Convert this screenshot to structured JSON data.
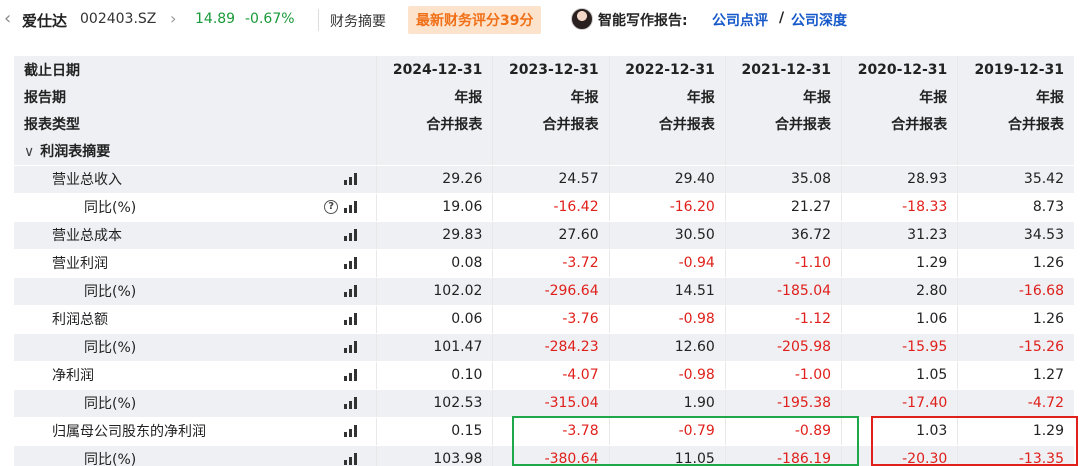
{
  "header": {
    "back_icon": "chevron-left-icon",
    "stock_name": "爱仕达",
    "stock_code": "002403.SZ",
    "chevron": "chevron-right-icon",
    "price": "14.89",
    "change": "-0.67%",
    "financial_summary": "财务摘要",
    "rating_badge": "最新财务评分39分",
    "ai_label": "智能写作报告:",
    "ai_link_1": "公司点评",
    "ai_slash": "/",
    "ai_link_2": "公司深度",
    "up_color": "#1a9a3a",
    "link_color": "#1558c9",
    "badge_color": "#f07018"
  },
  "table": {
    "header_rows": [
      {
        "label": "截止日期",
        "values": [
          "2024-12-31",
          "2023-12-31",
          "2022-12-31",
          "2021-12-31",
          "2020-12-31",
          "2019-12-31"
        ]
      },
      {
        "label": "报告期",
        "values": [
          "年报",
          "年报",
          "年报",
          "年报",
          "年报",
          "年报"
        ]
      },
      {
        "label": "报表类型",
        "values": [
          "合并报表",
          "合并报表",
          "合并报表",
          "合并报表",
          "合并报表",
          "合并报表"
        ]
      }
    ],
    "section_label": "利润表摘要",
    "rows": [
      {
        "label": "营业总收入",
        "level": 1,
        "help": false,
        "values": [
          "29.26",
          "24.57",
          "29.40",
          "35.08",
          "28.93",
          "35.42"
        ]
      },
      {
        "label": "同比(%)",
        "level": 2,
        "help": true,
        "values": [
          "19.06",
          "-16.42",
          "-16.20",
          "21.27",
          "-18.33",
          "8.73"
        ]
      },
      {
        "label": "营业总成本",
        "level": 1,
        "help": false,
        "values": [
          "29.83",
          "27.60",
          "30.50",
          "36.72",
          "31.23",
          "34.53"
        ]
      },
      {
        "label": "营业利润",
        "level": 1,
        "help": false,
        "values": [
          "0.08",
          "-3.72",
          "-0.94",
          "-1.10",
          "1.29",
          "1.26"
        ]
      },
      {
        "label": "同比(%)",
        "level": 2,
        "help": false,
        "values": [
          "102.02",
          "-296.64",
          "14.51",
          "-185.04",
          "2.80",
          "-16.68"
        ]
      },
      {
        "label": "利润总额",
        "level": 1,
        "help": false,
        "values": [
          "0.06",
          "-3.76",
          "-0.98",
          "-1.12",
          "1.06",
          "1.26"
        ]
      },
      {
        "label": "同比(%)",
        "level": 2,
        "help": false,
        "values": [
          "101.47",
          "-284.23",
          "12.60",
          "-205.98",
          "-15.95",
          "-15.26"
        ]
      },
      {
        "label": "净利润",
        "level": 1,
        "help": false,
        "values": [
          "0.10",
          "-4.07",
          "-0.98",
          "-1.00",
          "1.05",
          "1.27"
        ]
      },
      {
        "label": "同比(%)",
        "level": 2,
        "help": false,
        "values": [
          "102.53",
          "-315.04",
          "1.90",
          "-195.38",
          "-17.40",
          "-4.72"
        ]
      },
      {
        "label": "归属母公司股东的净利润",
        "level": 1,
        "help": false,
        "values": [
          "0.15",
          "-3.78",
          "-0.79",
          "-0.89",
          "1.03",
          "1.29"
        ]
      },
      {
        "label": "同比(%)",
        "level": 2,
        "help": false,
        "values": [
          "103.98",
          "-380.64",
          "11.05",
          "-186.19",
          "-20.30",
          "-13.35"
        ]
      }
    ],
    "negative_color": "#e0201b",
    "highlight_colors": {
      "green": "#1ea84a",
      "red": "#e0201b"
    }
  }
}
